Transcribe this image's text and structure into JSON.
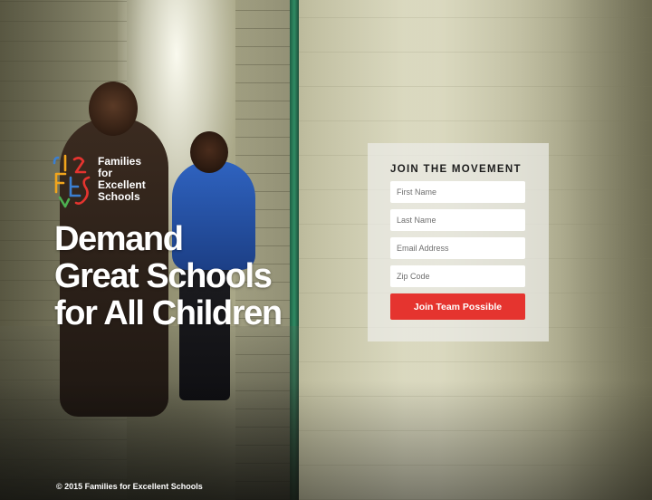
{
  "brand": {
    "logo_lines": [
      "Families",
      "for",
      "Excellent",
      "Schools"
    ],
    "logo_colors": [
      "#3b7fd1",
      "#f2a51c",
      "#e5342f",
      "#4caf50",
      "#ffd400"
    ]
  },
  "hero": {
    "headline_lines": [
      "Demand",
      "Great Schools",
      "for All Children"
    ]
  },
  "form": {
    "title": "JOIN THE MOVEMENT",
    "first_name_placeholder": "First Name",
    "last_name_placeholder": "Last Name",
    "email_placeholder": "Email Address",
    "zip_placeholder": "Zip Code",
    "submit_label": "Join Team Possible",
    "submit_color": "#e5342f"
  },
  "footer": {
    "copyright": "© 2015 Families for Excellent Schools"
  }
}
